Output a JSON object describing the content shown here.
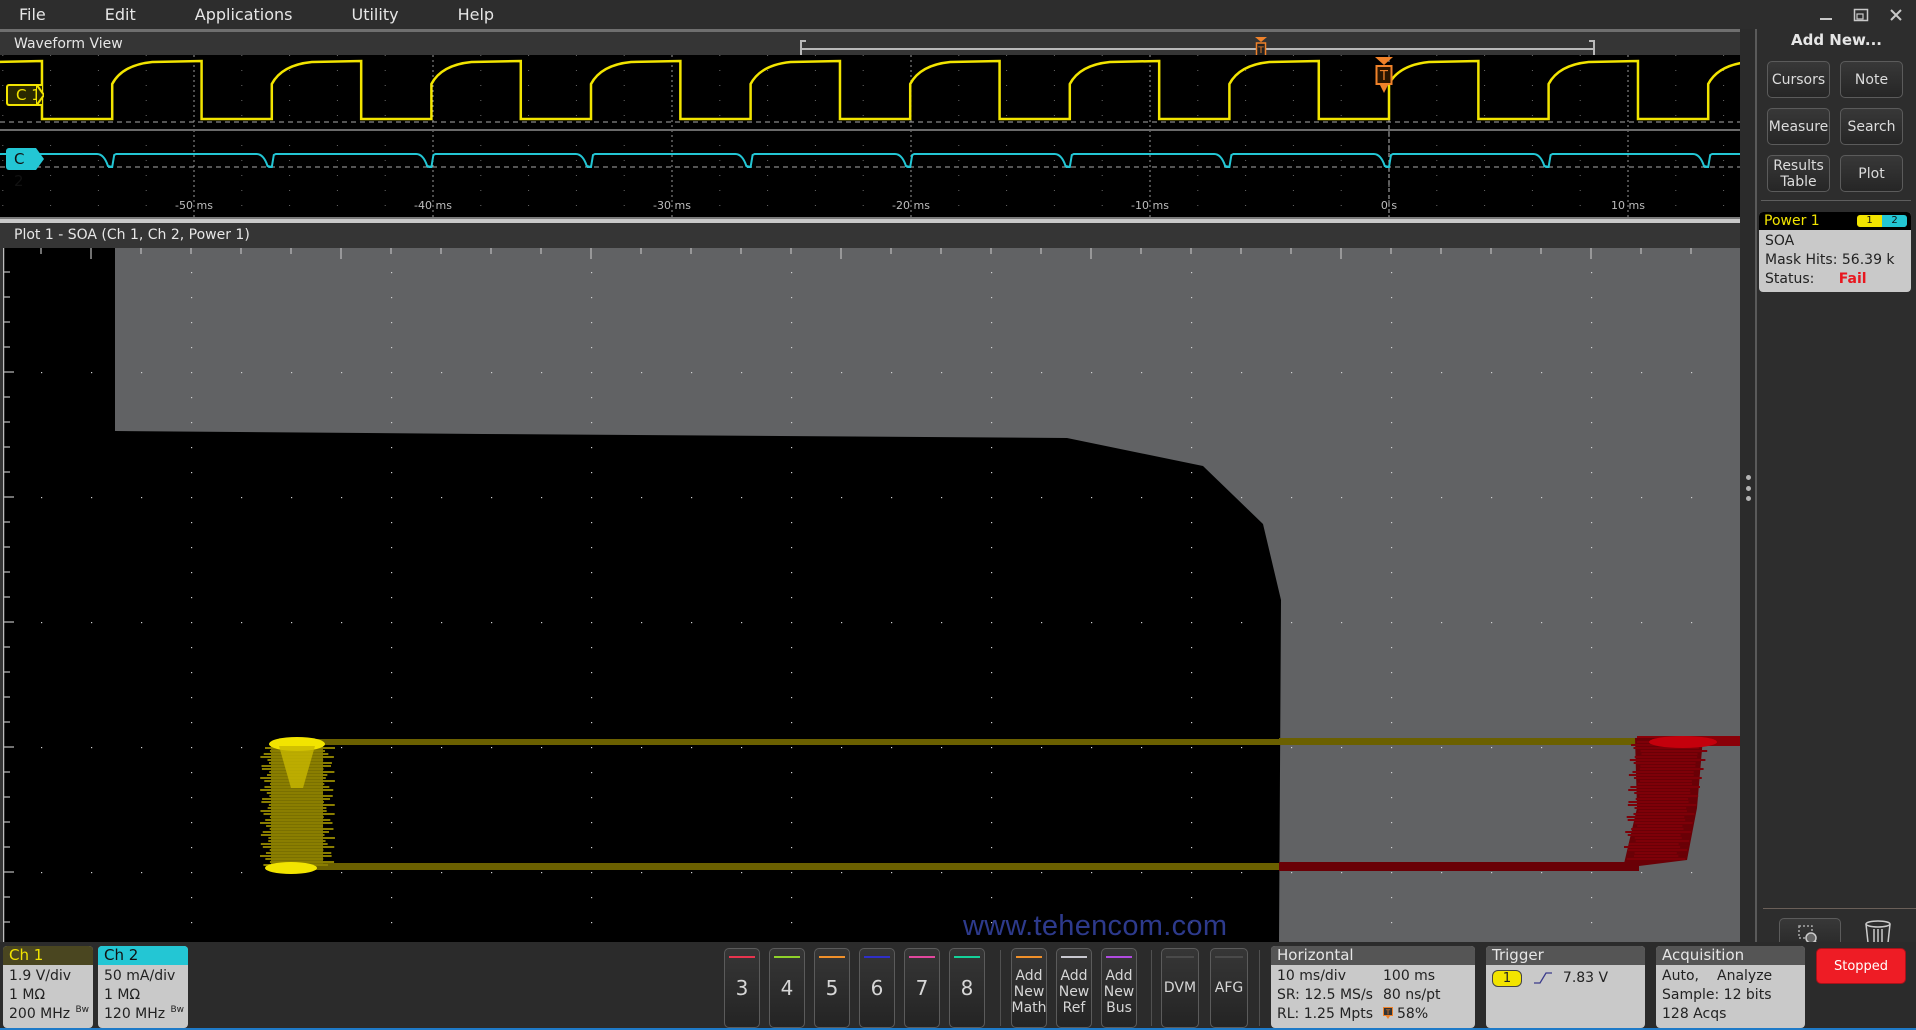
{
  "menubar": {
    "items": [
      "File",
      "Edit",
      "Applications",
      "Utility",
      "Help"
    ],
    "window_controls": [
      "minimize-icon",
      "restore-icon",
      "close-icon"
    ]
  },
  "waveform_view": {
    "title": "Waveform View",
    "channels": [
      {
        "label": "C 1",
        "color": "#f2e400"
      },
      {
        "label": "C 2",
        "color": "#23c6d4"
      }
    ],
    "time_labels": [
      "-50 ms",
      "-40 ms",
      "-30 ms",
      "-20 ms",
      "-10 ms",
      "0 s",
      "10 ms"
    ],
    "trigger_marker": "T",
    "time_per_div": "10 ms/div"
  },
  "plot": {
    "title": "Plot 1 - SOA (Ch 1, Ch 2, Power 1)",
    "mask_color": "#616264",
    "pass_trace_color": "#f2e400",
    "fail_trace_color": "#c0000c"
  },
  "watermark": "www.tehencom.com",
  "sidebar": {
    "title": "Add New...",
    "buttons": [
      {
        "label": "Cursors"
      },
      {
        "label": "Note"
      },
      {
        "label": "Measure"
      },
      {
        "label": "Search"
      },
      {
        "label": "Results Table"
      },
      {
        "label": "Plot"
      }
    ],
    "power_badge": {
      "name": "Power 1",
      "sources": [
        "1",
        "2"
      ],
      "type": "SOA",
      "mask_hits_label": "Mask Hits:",
      "mask_hits_value": "56.39 k",
      "status_label": "Status:",
      "status_value": "Fail",
      "status_color": "#e8171f"
    }
  },
  "bottombar": {
    "ch1": {
      "title": "Ch 1",
      "scale": "1.9 V/div",
      "impedance": "1 MΩ",
      "bandwidth": "200 MHz",
      "bw_mark": "Bw",
      "color": "#f2e400"
    },
    "ch2": {
      "title": "Ch 2",
      "scale": "50 mA/div",
      "impedance": "1 MΩ",
      "bandwidth": "120 MHz",
      "bw_mark": "Bw",
      "color": "#23c6d4"
    },
    "channel_buttons": [
      {
        "label": "3",
        "color": "#e8344e"
      },
      {
        "label": "4",
        "color": "#8fd22a"
      },
      {
        "label": "5",
        "color": "#f0902a"
      },
      {
        "label": "6",
        "color": "#2f2fc8"
      },
      {
        "label": "7",
        "color": "#e2479e"
      },
      {
        "label": "8",
        "color": "#14d29a"
      }
    ],
    "add_buttons": [
      {
        "label": "Add New Math",
        "color": "#f0902a"
      },
      {
        "label": "Add New Ref",
        "color": "#c8c8d0"
      },
      {
        "label": "Add New Bus",
        "color": "#b04be0"
      }
    ],
    "tool_buttons": [
      {
        "label": "DVM"
      },
      {
        "label": "AFG"
      }
    ],
    "horizontal": {
      "title": "Horizontal",
      "scale": "10 ms/div",
      "duration": "100 ms",
      "sample_rate": "SR: 12.5 MS/s",
      "resolution": "80 ns/pt",
      "record_length": "RL: 1.25 Mpts",
      "trigger_position": "58%"
    },
    "trigger": {
      "title": "Trigger",
      "source": "1",
      "slope": "rising",
      "level": "7.83 V"
    },
    "acquisition": {
      "title": "Acquisition",
      "mode": "Auto,",
      "state": "Analyze",
      "sample": "Sample: 12 bits",
      "count": "128 Acqs"
    },
    "run_state": "Stopped"
  }
}
